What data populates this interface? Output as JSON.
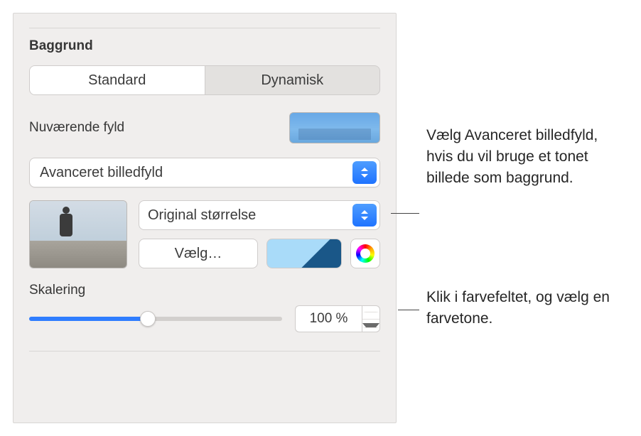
{
  "sectionTitle": "Baggrund",
  "segmented": {
    "standard": "Standard",
    "dynamic": "Dynamisk"
  },
  "currentFillLabel": "Nuværende fyld",
  "fillTypeSelected": "Avanceret billedfyld",
  "scaleModeSelected": "Original størrelse",
  "chooseButton": "Vælg…",
  "scalingLabel": "Skalering",
  "scalingValue": "100 %",
  "tint": "#a9dbf9",
  "callout1": "Vælg Avanceret billedfyld, hvis du vil bruge et tonet billede som baggrund.",
  "callout2": "Klik i farvefeltet, og vælg en farvetone."
}
